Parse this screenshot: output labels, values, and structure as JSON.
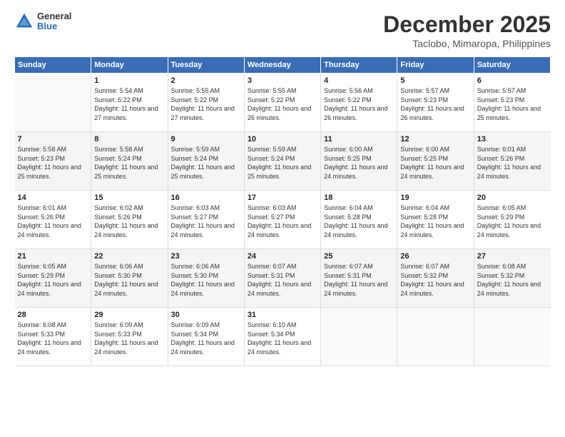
{
  "logo": {
    "line1": "General",
    "line2": "Blue"
  },
  "title": "December 2025",
  "location": "Taclobo, Mimaropa, Philippines",
  "weekdays": [
    "Sunday",
    "Monday",
    "Tuesday",
    "Wednesday",
    "Thursday",
    "Friday",
    "Saturday"
  ],
  "weeks": [
    [
      {
        "day": "",
        "sunrise": "",
        "sunset": "",
        "daylight": ""
      },
      {
        "day": "1",
        "sunrise": "Sunrise: 5:54 AM",
        "sunset": "Sunset: 5:22 PM",
        "daylight": "Daylight: 11 hours and 27 minutes."
      },
      {
        "day": "2",
        "sunrise": "Sunrise: 5:55 AM",
        "sunset": "Sunset: 5:22 PM",
        "daylight": "Daylight: 11 hours and 27 minutes."
      },
      {
        "day": "3",
        "sunrise": "Sunrise: 5:55 AM",
        "sunset": "Sunset: 5:22 PM",
        "daylight": "Daylight: 11 hours and 26 minutes."
      },
      {
        "day": "4",
        "sunrise": "Sunrise: 5:56 AM",
        "sunset": "Sunset: 5:22 PM",
        "daylight": "Daylight: 11 hours and 26 minutes."
      },
      {
        "day": "5",
        "sunrise": "Sunrise: 5:57 AM",
        "sunset": "Sunset: 5:23 PM",
        "daylight": "Daylight: 11 hours and 26 minutes."
      },
      {
        "day": "6",
        "sunrise": "Sunrise: 5:57 AM",
        "sunset": "Sunset: 5:23 PM",
        "daylight": "Daylight: 11 hours and 25 minutes."
      }
    ],
    [
      {
        "day": "7",
        "sunrise": "Sunrise: 5:58 AM",
        "sunset": "Sunset: 5:23 PM",
        "daylight": "Daylight: 11 hours and 25 minutes."
      },
      {
        "day": "8",
        "sunrise": "Sunrise: 5:58 AM",
        "sunset": "Sunset: 5:24 PM",
        "daylight": "Daylight: 11 hours and 25 minutes."
      },
      {
        "day": "9",
        "sunrise": "Sunrise: 5:59 AM",
        "sunset": "Sunset: 5:24 PM",
        "daylight": "Daylight: 11 hours and 25 minutes."
      },
      {
        "day": "10",
        "sunrise": "Sunrise: 5:59 AM",
        "sunset": "Sunset: 5:24 PM",
        "daylight": "Daylight: 11 hours and 25 minutes."
      },
      {
        "day": "11",
        "sunrise": "Sunrise: 6:00 AM",
        "sunset": "Sunset: 5:25 PM",
        "daylight": "Daylight: 11 hours and 24 minutes."
      },
      {
        "day": "12",
        "sunrise": "Sunrise: 6:00 AM",
        "sunset": "Sunset: 5:25 PM",
        "daylight": "Daylight: 11 hours and 24 minutes."
      },
      {
        "day": "13",
        "sunrise": "Sunrise: 6:01 AM",
        "sunset": "Sunset: 5:26 PM",
        "daylight": "Daylight: 11 hours and 24 minutes."
      }
    ],
    [
      {
        "day": "14",
        "sunrise": "Sunrise: 6:01 AM",
        "sunset": "Sunset: 5:26 PM",
        "daylight": "Daylight: 11 hours and 24 minutes."
      },
      {
        "day": "15",
        "sunrise": "Sunrise: 6:02 AM",
        "sunset": "Sunset: 5:26 PM",
        "daylight": "Daylight: 11 hours and 24 minutes."
      },
      {
        "day": "16",
        "sunrise": "Sunrise: 6:03 AM",
        "sunset": "Sunset: 5:27 PM",
        "daylight": "Daylight: 11 hours and 24 minutes."
      },
      {
        "day": "17",
        "sunrise": "Sunrise: 6:03 AM",
        "sunset": "Sunset: 5:27 PM",
        "daylight": "Daylight: 11 hours and 24 minutes."
      },
      {
        "day": "18",
        "sunrise": "Sunrise: 6:04 AM",
        "sunset": "Sunset: 5:28 PM",
        "daylight": "Daylight: 11 hours and 24 minutes."
      },
      {
        "day": "19",
        "sunrise": "Sunrise: 6:04 AM",
        "sunset": "Sunset: 5:28 PM",
        "daylight": "Daylight: 11 hours and 24 minutes."
      },
      {
        "day": "20",
        "sunrise": "Sunrise: 6:05 AM",
        "sunset": "Sunset: 5:29 PM",
        "daylight": "Daylight: 11 hours and 24 minutes."
      }
    ],
    [
      {
        "day": "21",
        "sunrise": "Sunrise: 6:05 AM",
        "sunset": "Sunset: 5:29 PM",
        "daylight": "Daylight: 11 hours and 24 minutes."
      },
      {
        "day": "22",
        "sunrise": "Sunrise: 6:06 AM",
        "sunset": "Sunset: 5:30 PM",
        "daylight": "Daylight: 11 hours and 24 minutes."
      },
      {
        "day": "23",
        "sunrise": "Sunrise: 6:06 AM",
        "sunset": "Sunset: 5:30 PM",
        "daylight": "Daylight: 11 hours and 24 minutes."
      },
      {
        "day": "24",
        "sunrise": "Sunrise: 6:07 AM",
        "sunset": "Sunset: 5:31 PM",
        "daylight": "Daylight: 11 hours and 24 minutes."
      },
      {
        "day": "25",
        "sunrise": "Sunrise: 6:07 AM",
        "sunset": "Sunset: 5:31 PM",
        "daylight": "Daylight: 11 hours and 24 minutes."
      },
      {
        "day": "26",
        "sunrise": "Sunrise: 6:07 AM",
        "sunset": "Sunset: 5:32 PM",
        "daylight": "Daylight: 11 hours and 24 minutes."
      },
      {
        "day": "27",
        "sunrise": "Sunrise: 6:08 AM",
        "sunset": "Sunset: 5:32 PM",
        "daylight": "Daylight: 11 hours and 24 minutes."
      }
    ],
    [
      {
        "day": "28",
        "sunrise": "Sunrise: 6:08 AM",
        "sunset": "Sunset: 5:33 PM",
        "daylight": "Daylight: 11 hours and 24 minutes."
      },
      {
        "day": "29",
        "sunrise": "Sunrise: 6:09 AM",
        "sunset": "Sunset: 5:33 PM",
        "daylight": "Daylight: 11 hours and 24 minutes."
      },
      {
        "day": "30",
        "sunrise": "Sunrise: 6:09 AM",
        "sunset": "Sunset: 5:34 PM",
        "daylight": "Daylight: 11 hours and 24 minutes."
      },
      {
        "day": "31",
        "sunrise": "Sunrise: 6:10 AM",
        "sunset": "Sunset: 5:34 PM",
        "daylight": "Daylight: 11 hours and 24 minutes."
      },
      {
        "day": "",
        "sunrise": "",
        "sunset": "",
        "daylight": ""
      },
      {
        "day": "",
        "sunrise": "",
        "sunset": "",
        "daylight": ""
      },
      {
        "day": "",
        "sunrise": "",
        "sunset": "",
        "daylight": ""
      }
    ]
  ]
}
